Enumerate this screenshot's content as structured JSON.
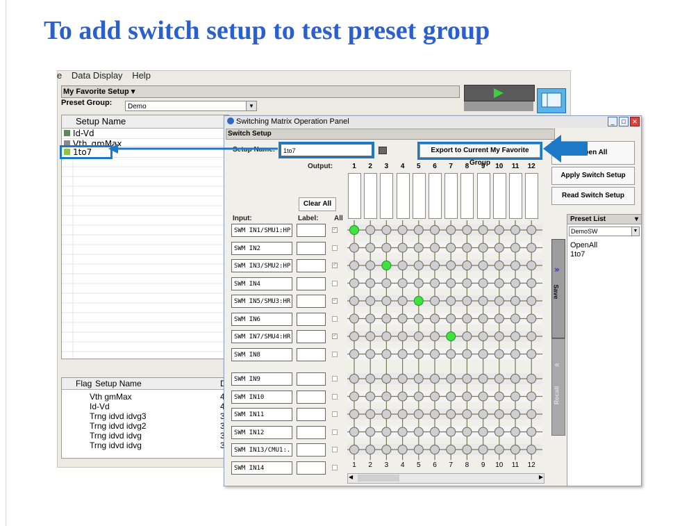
{
  "slide": {
    "title": "To add switch setup to test preset group"
  },
  "app": {
    "menu": [
      "e",
      "Data Display",
      "Help"
    ],
    "favorite_setup": "My Favorite Setup",
    "preset_group_label": "Preset Group:",
    "preset_group_value": "Demo",
    "setup_list": {
      "header": "Setup Name",
      "items": [
        "Id-Vd",
        "Vth_gmMax",
        "1to7"
      ]
    },
    "flag_table": {
      "col_flag": "Flag",
      "col_name": "Setup Name",
      "col_extra": "D",
      "rows": [
        "Vth gmMax",
        "Id-Vd",
        "Trng idvd idvg3",
        "Trng idvd idvg2",
        "Trng idvd idvg",
        "Trng idvd idvg"
      ],
      "extras": [
        "4",
        "4",
        "3",
        "3",
        "3",
        "3"
      ]
    }
  },
  "dialog": {
    "title": "Switching Matrix Operation Panel",
    "section": "Switch Setup",
    "setup_name_label": "Setup Name:",
    "setup_name_value": "1to7",
    "export_button": "Export to Current My Favorite Group",
    "open_all_button": "Open All",
    "apply_button": "Apply Switch Setup",
    "read_button": "Read Switch Setup",
    "output_label": "Output:",
    "clear_all_button": "Clear All",
    "input_label": "Input:",
    "label_label": "Label:",
    "all_label": "All",
    "columns": [
      "1",
      "2",
      "3",
      "4",
      "5",
      "6",
      "7",
      "8",
      "9",
      "10",
      "11",
      "12"
    ],
    "inputs": [
      "SWM IN1/SMU1:HP",
      "SWM IN2",
      "SWM IN3/SMU2:HP",
      "SWM IN4",
      "SWM IN5/SMU3:HR",
      "SWM IN6",
      "SWM IN7/SMU4:HR",
      "SWM IN8",
      "SWM IN9",
      "SWM IN10",
      "SWM IN11",
      "SWM IN12",
      "SWM IN13/CMU1:...",
      "SWM IN14"
    ],
    "checked_all": [
      true,
      false,
      true,
      false,
      true,
      false,
      true,
      false,
      false,
      false,
      false,
      false,
      false,
      false
    ],
    "connections": [
      [
        0,
        0
      ],
      [
        2,
        2
      ],
      [
        4,
        4
      ],
      [
        6,
        6
      ]
    ],
    "save_tab": "Save",
    "recall_tab": "Recall",
    "preset_list_label": "Preset List",
    "preset_list_value": "DemoSW",
    "preset_items": [
      "OpenAll",
      "1to7"
    ]
  },
  "colors": {
    "accent_blue": "#1e78c8",
    "title_blue": "#2a5fcf",
    "on_node": "#3ee33e"
  }
}
